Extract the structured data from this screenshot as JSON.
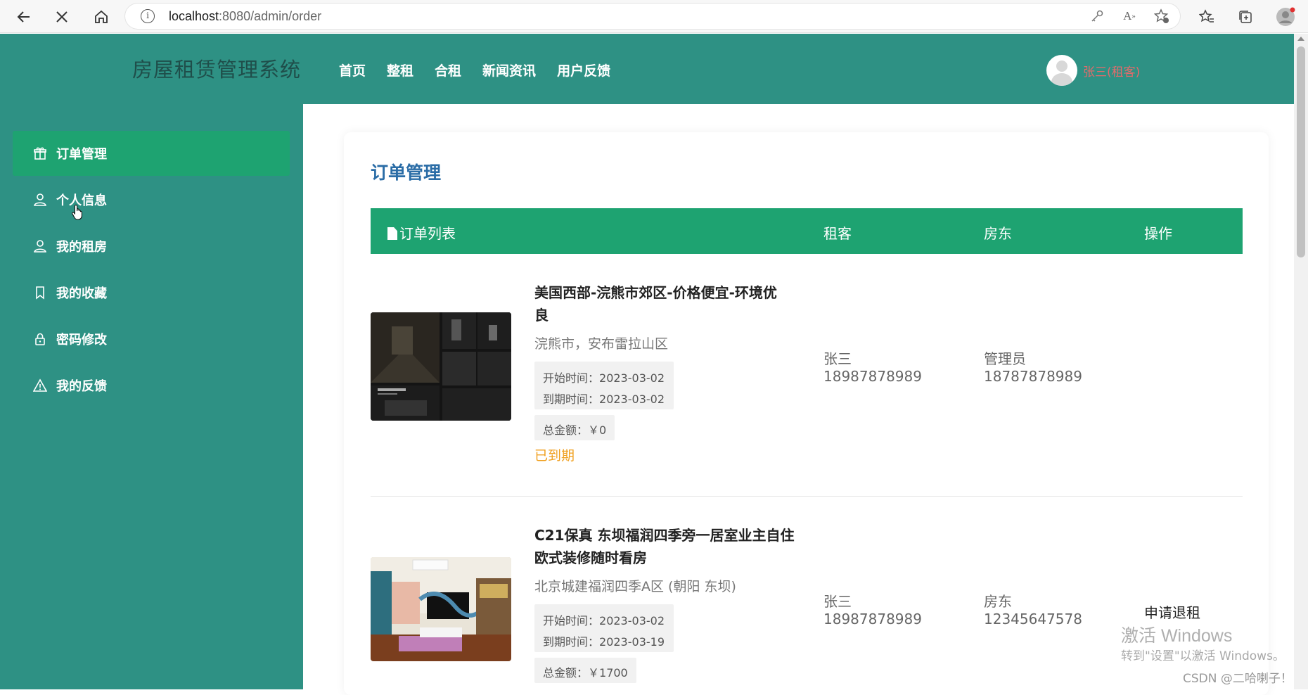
{
  "browser": {
    "url_host": "localhost",
    "url_path": ":8080/admin/order"
  },
  "header": {
    "brand": "房屋租赁管理系统",
    "nav": [
      "首页",
      "整租",
      "合租",
      "新闻资讯",
      "用户反馈"
    ],
    "user": "张三(租客)"
  },
  "sidebar": {
    "items": [
      {
        "label": "订单管理",
        "icon": "gift-icon",
        "active": true
      },
      {
        "label": "个人信息",
        "icon": "user-icon",
        "active": false
      },
      {
        "label": "我的租房",
        "icon": "user-icon",
        "active": false
      },
      {
        "label": "我的收藏",
        "icon": "bookmark-icon",
        "active": false
      },
      {
        "label": "密码修改",
        "icon": "lock-icon",
        "active": false
      },
      {
        "label": "我的反馈",
        "icon": "warning-icon",
        "active": false
      }
    ]
  },
  "main": {
    "title": "订单管理",
    "columns": {
      "list": "订单列表",
      "tenant": "租客",
      "landlord": "房东",
      "action": "操作"
    },
    "orders": [
      {
        "title": "美国西部-浣熊市郊区-价格便宜-环境优良",
        "title_line1": "美国西部-浣熊市郊区-价格便宜-环境优",
        "title_line2": "良",
        "address": "浣熊市，安布雷拉山区",
        "start_label": "开始时间：",
        "start": "2023-03-02",
        "end_label": "到期时间：",
        "end": "2023-03-02",
        "amount_label": "总金额：",
        "amount": "￥0",
        "status": "已到期",
        "tenant_name": "张三",
        "tenant_phone": "18987878989",
        "landlord_name": "管理员",
        "landlord_phone": "18787878989",
        "action": ""
      },
      {
        "title": "C21保真 东坝福润四季旁一居室业主自住欧式装修随时看房",
        "title_line1": "C21保真 东坝福润四季旁一居室业主自住",
        "title_line2": "欧式装修随时看房",
        "address": "北京城建福润四季A区 (朝阳 东坝)",
        "start_label": "开始时间：",
        "start": "2023-03-02",
        "end_label": "到期时间：",
        "end": "2023-03-19",
        "amount_label": "总金额：",
        "amount": "￥1700",
        "status": "",
        "tenant_name": "张三",
        "tenant_phone": "18987878989",
        "landlord_name": "房东",
        "landlord_phone": "12345647578",
        "action": "申请退租"
      }
    ]
  },
  "overlay": {
    "activate_title": "激活 Windows",
    "activate_hint": "转到\"设置\"以激活 Windows。",
    "csdn": "CSDN @二哈喇子！"
  },
  "colors": {
    "header_bg": "#2e9184",
    "active_green": "#1ea371",
    "status_orange": "#f0a020",
    "title_blue": "#2a6ca6"
  }
}
